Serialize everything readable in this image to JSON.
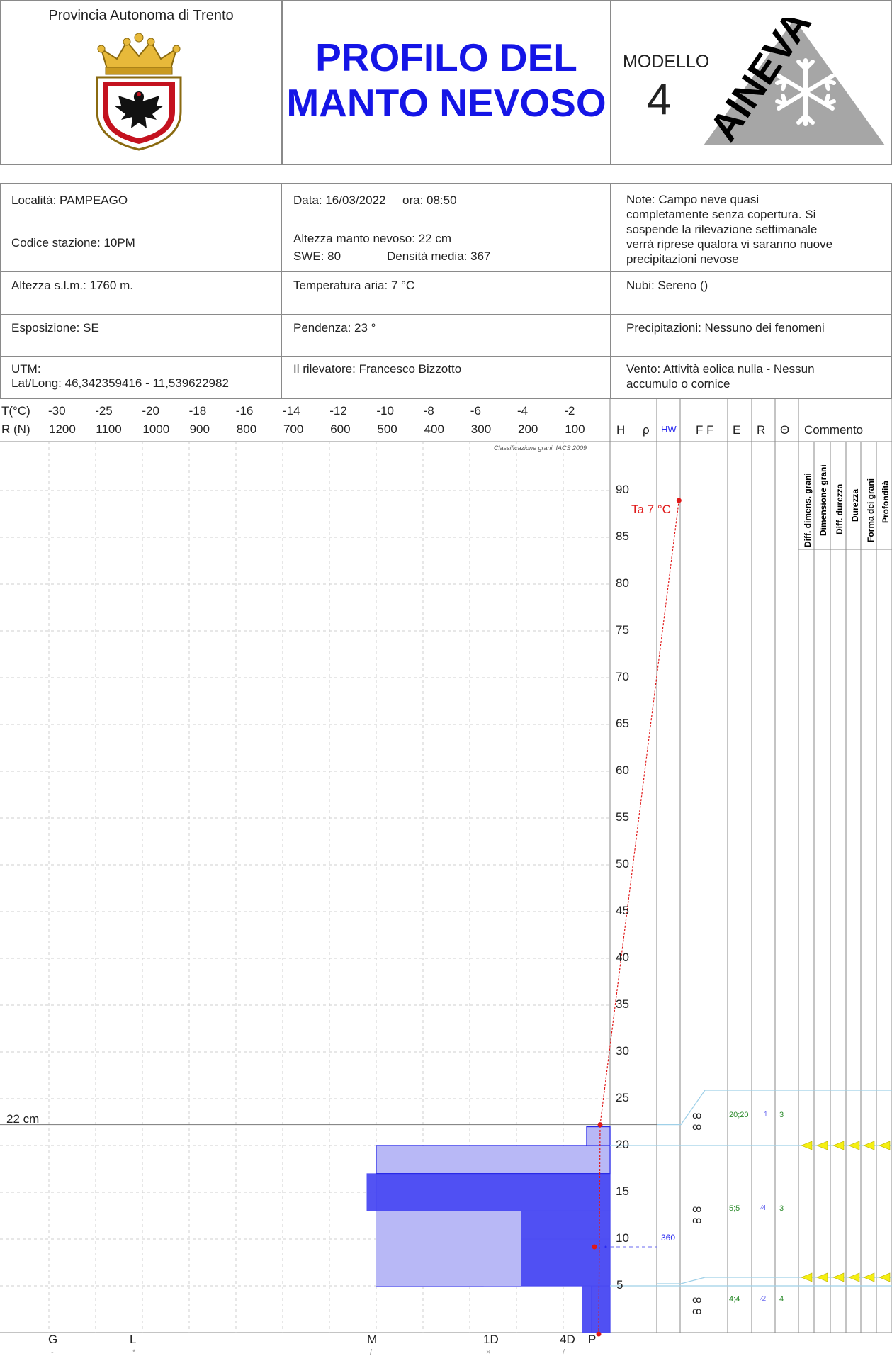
{
  "header": {
    "province": "Provincia Autonoma di Trento",
    "title_line1": "PROFILO DEL",
    "title_line2": "MANTO NEVOSO",
    "model_label": "MODELLO",
    "model_number": "4",
    "logo_text": "AINEVA"
  },
  "info": {
    "locality": "Località: PAMPEAGO",
    "station_code": "Codice stazione: 10PM",
    "altitude": "Altezza s.l.m.: 1760 m.",
    "exposure": "Esposizione: SE",
    "utm": "UTM:",
    "latlong": "Lat/Long: 46,342359416 - 11,539622982",
    "date": "Data: 16/03/2022",
    "time": "ora: 08:50",
    "snow_depth": "Altezza manto nevoso: 22 cm",
    "swe": "SWE: 80",
    "density": "Densità media: 367",
    "air_temp": "Temperatura aria: 7 °C",
    "slope": "Pendenza: 23 °",
    "observer": "Il rilevatore: Francesco Bizzotto",
    "notes": [
      "Note: Campo neve quasi",
      "completamente senza copertura. Si",
      "sospende la rilevazione settimanale",
      "verrà riprese qualora vi saranno nuove",
      "precipitazioni nevose"
    ],
    "clouds": "Nubi: Sereno ()",
    "precipitation": "Precipitazioni: Nessuno dei fenomeni",
    "wind": [
      "Vento: Attività eolica nulla - Nessun",
      "accumulo o cornice"
    ]
  },
  "axes": {
    "t_label": "T(°C)",
    "r_label": "R (N)",
    "t_ticks": [
      "-30",
      "-25",
      "-20",
      "-18",
      "-16",
      "-14",
      "-12",
      "-10",
      "-8",
      "-6",
      "-4",
      "-2"
    ],
    "r_ticks": [
      "1200",
      "1100",
      "1000",
      "900",
      "800",
      "700",
      "600",
      "500",
      "400",
      "300",
      "200",
      "100"
    ],
    "columns": [
      "H",
      "ρ",
      "HW",
      "F F",
      "E",
      "R",
      "Θ",
      "Commento"
    ],
    "h_ticks": [
      "90",
      "85",
      "80",
      "75",
      "70",
      "65",
      "60",
      "55",
      "50",
      "45",
      "40",
      "35",
      "30",
      "25",
      "20",
      "15",
      "10",
      "5"
    ],
    "hardness_labels": [
      "G",
      "L",
      "M",
      "1D",
      "4D",
      "P"
    ],
    "hardness_symbols": [
      "-",
      "*",
      "/",
      "×",
      "/",
      ""
    ],
    "classification_note": "Classificazione grani: IACS 2009",
    "snow_height_label": "22 cm",
    "air_temp_label": "Ta 7 °C",
    "vertical_headers": [
      "Diff. dimens. grani",
      "Dimensione grani",
      "Diff. durezza",
      "Durezza",
      "Forma dei grani",
      "Profondità"
    ]
  },
  "layers_table": [
    {
      "grain_shape": "ꝏ ꝏ",
      "size": "20;20",
      "hardness": "1",
      "wetness": "3"
    },
    {
      "grain_shape": "ꝏ ꝏ",
      "size": "5;5",
      "hardness": "⁄4",
      "wetness": "3"
    },
    {
      "grain_shape": "ꝏ ꝏ",
      "size": "4;4",
      "hardness": "⁄2",
      "wetness": "4"
    }
  ],
  "density_measure": "360",
  "chart_data": {
    "type": "snow_profile",
    "height_range_cm": [
      0,
      95
    ],
    "snow_height_cm": 22,
    "air_temperature_c": 7,
    "ram_resistance": [
      {
        "from_cm": 0,
        "to_cm": 5,
        "R_N": 60
      },
      {
        "from_cm": 5,
        "to_cm": 10,
        "R_N": 270
      },
      {
        "from_cm": 10,
        "to_cm": 13,
        "R_N": 270
      },
      {
        "from_cm": 13,
        "to_cm": 17,
        "R_N": 520
      },
      {
        "from_cm": 17,
        "to_cm": 20,
        "R_N": 500
      },
      {
        "from_cm": 20,
        "to_cm": 22,
        "R_N": 50
      }
    ],
    "hand_hardness": [
      {
        "from_cm": 0,
        "to_cm": 5,
        "R_N": 40
      },
      {
        "from_cm": 5,
        "to_cm": 13,
        "R_N": 500
      },
      {
        "from_cm": 13,
        "to_cm": 20,
        "R_N": 500
      },
      {
        "from_cm": 20,
        "to_cm": 22,
        "R_N": 50
      }
    ],
    "temperature_profile": [
      {
        "h_cm": 0,
        "T_c": 0
      },
      {
        "h_cm": 10,
        "T_c": 0
      },
      {
        "h_cm": 22,
        "T_c": 0
      }
    ],
    "layer_boundaries_cm": [
      5,
      20
    ]
  }
}
